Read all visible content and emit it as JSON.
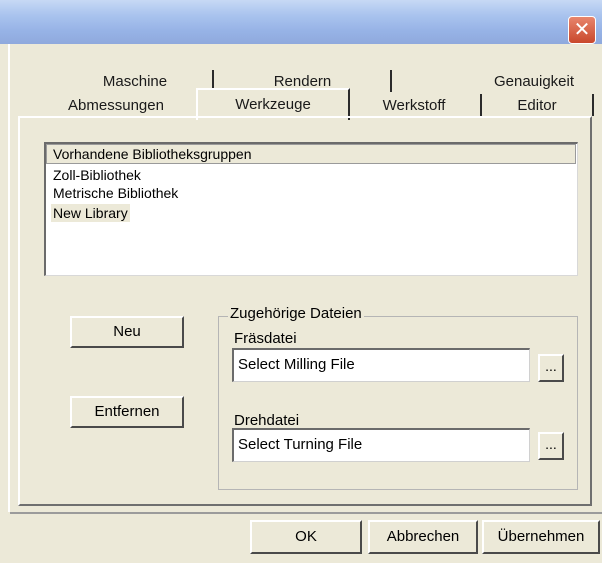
{
  "window": {
    "close_glyph": "✕"
  },
  "tabs": {
    "row1": [
      "Maschine",
      "Rendern",
      "Genauigkeit"
    ],
    "row2": [
      "Abmessungen",
      "Werkzeuge",
      "Werkstoff",
      "Editor"
    ],
    "active": "Werkzeuge"
  },
  "libraries": {
    "header": "Vorhandene Bibliotheksgruppen",
    "items": [
      "Zoll-Bibliothek",
      "Metrische Bibliothek",
      "New Library"
    ],
    "selected": "New Library"
  },
  "actions": {
    "new_label": "Neu",
    "remove_label": "Entfernen"
  },
  "files": {
    "group_title": "Zugehörige Dateien",
    "milling_label": "Fräsdatei",
    "milling_value": "Select Milling File",
    "turning_label": "Drehdatei",
    "turning_value": "Select Turning File",
    "browse_label": "..."
  },
  "dialog": {
    "ok_label": "OK",
    "cancel_label": "Abbrechen",
    "apply_label": "Übernehmen"
  }
}
